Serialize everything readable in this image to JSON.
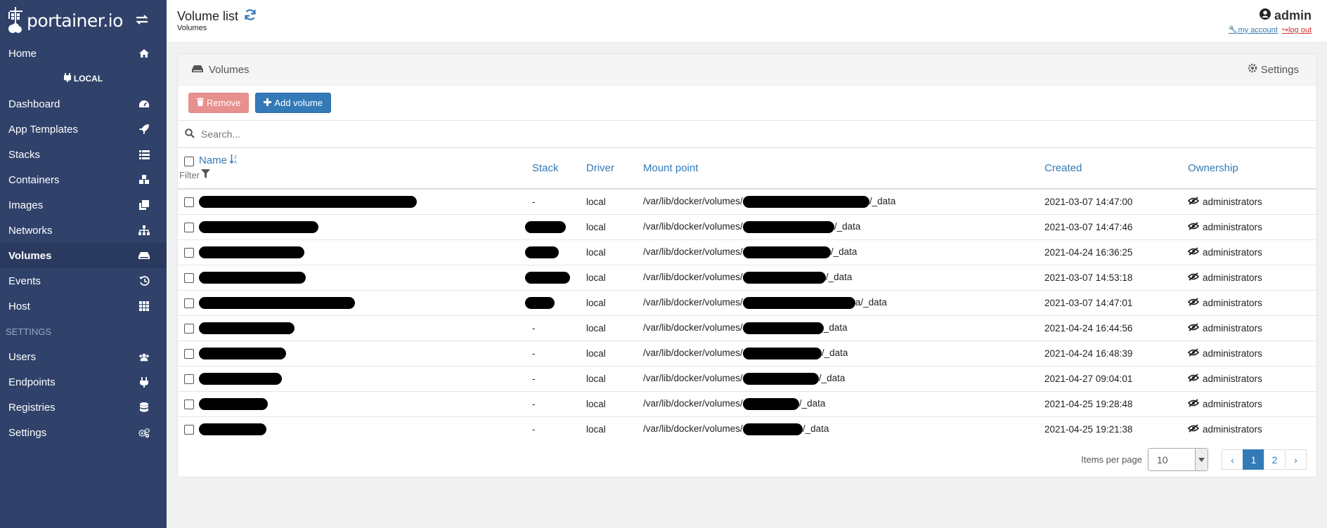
{
  "brand": {
    "logo_text": "portainer.io"
  },
  "sidebar": {
    "endpoint": "LOCAL",
    "items_top": [
      {
        "label": "Home",
        "icon": "home-icon"
      }
    ],
    "items": [
      {
        "label": "Dashboard",
        "icon": "tachometer-icon"
      },
      {
        "label": "App Templates",
        "icon": "rocket-icon"
      },
      {
        "label": "Stacks",
        "icon": "list-icon"
      },
      {
        "label": "Containers",
        "icon": "cubes-icon"
      },
      {
        "label": "Images",
        "icon": "clone-icon"
      },
      {
        "label": "Networks",
        "icon": "sitemap-icon"
      },
      {
        "label": "Volumes",
        "icon": "hdd-icon",
        "active": true
      },
      {
        "label": "Events",
        "icon": "history-icon"
      },
      {
        "label": "Host",
        "icon": "th-icon"
      }
    ],
    "settings_title": "SETTINGS",
    "settings_items": [
      {
        "label": "Users",
        "icon": "users-icon"
      },
      {
        "label": "Endpoints",
        "icon": "plug-icon"
      },
      {
        "label": "Registries",
        "icon": "database-icon"
      },
      {
        "label": "Settings",
        "icon": "cogs-icon"
      }
    ]
  },
  "header": {
    "title": "Volume list",
    "breadcrumb": "Volumes",
    "user": "admin",
    "my_account": "my account",
    "log_out": "log out"
  },
  "panel": {
    "title": "Volumes",
    "settings": "Settings",
    "remove_label": "Remove",
    "add_label": "Add volume",
    "search_placeholder": "Search..."
  },
  "table": {
    "headers": {
      "name": "Name",
      "filter": "Filter",
      "stack": "Stack",
      "driver": "Driver",
      "mount": "Mount point",
      "created": "Created",
      "ownership": "Ownership"
    },
    "rows": [
      {
        "stack": "-",
        "driver": "local",
        "mount_prefix": "/var/lib/docker/volumes/",
        "mount_suffix": "/_data",
        "created": "2021-03-07 14:47:00",
        "ownership": "administrators"
      },
      {
        "stack": "",
        "driver": "local",
        "mount_prefix": "/var/lib/docker/volumes/",
        "mount_suffix": "/_data",
        "created": "2021-03-07 14:47:46",
        "ownership": "administrators"
      },
      {
        "stack": "",
        "driver": "local",
        "mount_prefix": "/var/lib/docker/volumes/",
        "mount_suffix": "/_data",
        "created": "2021-04-24 16:36:25",
        "ownership": "administrators"
      },
      {
        "stack": "",
        "driver": "local",
        "mount_prefix": "/var/lib/docker/volumes/",
        "mount_suffix": "/_data",
        "created": "2021-03-07 14:53:18",
        "ownership": "administrators"
      },
      {
        "stack": "",
        "driver": "local",
        "mount_prefix": "/var/lib/docker/volumes/",
        "mount_suffix": "a/_data",
        "created": "2021-03-07 14:47:01",
        "ownership": "administrators"
      },
      {
        "stack": "-",
        "driver": "local",
        "mount_prefix": "/var/lib/docker/volumes/",
        "mount_suffix": "_data",
        "created": "2021-04-24 16:44:56",
        "ownership": "administrators"
      },
      {
        "stack": "-",
        "driver": "local",
        "mount_prefix": "/var/lib/docker/volumes/",
        "mount_suffix": "/_data",
        "created": "2021-04-24 16:48:39",
        "ownership": "administrators"
      },
      {
        "stack": "-",
        "driver": "local",
        "mount_prefix": "/var/lib/docker/volumes/",
        "mount_suffix": "/_data",
        "created": "2021-04-27 09:04:01",
        "ownership": "administrators"
      },
      {
        "stack": "-",
        "driver": "local",
        "mount_prefix": "/var/lib/docker/volumes/",
        "mount_suffix": "/_data",
        "created": "2021-04-25 19:28:48",
        "ownership": "administrators"
      },
      {
        "stack": "-",
        "driver": "local",
        "mount_prefix": "/var/lib/docker/volumes/",
        "mount_suffix": "/_data",
        "created": "2021-04-25 19:21:38",
        "ownership": "administrators"
      }
    ]
  },
  "pagination": {
    "items_per_page_label": "Items per page",
    "items_per_page": "10",
    "prev": "‹",
    "pages": [
      "1",
      "2"
    ],
    "next": "›",
    "active_page": "1"
  },
  "colors": {
    "sidebar_bg": "#30426a",
    "accent": "#337ab7",
    "remove_btn": "#e8908d"
  }
}
